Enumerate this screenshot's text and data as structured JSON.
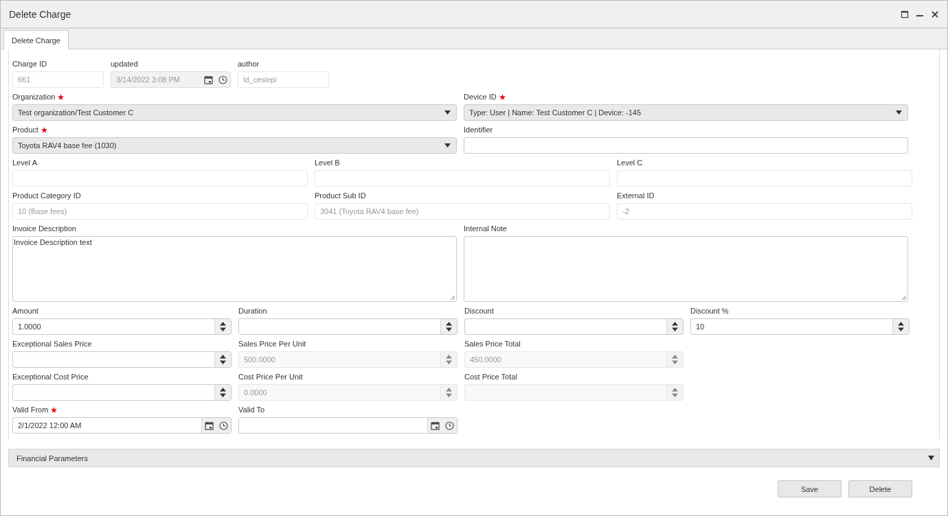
{
  "window": {
    "title": "Delete Charge"
  },
  "tabs": [
    {
      "label": "Delete Charge",
      "selected": true
    }
  ],
  "rows": [
    {
      "kind": "meta",
      "fields": [
        {
          "label": "Charge ID",
          "kind": "text",
          "value": "661",
          "required": false,
          "disabled": true
        },
        {
          "label": "updated",
          "kind": "date",
          "value": "3/14/2022 3:08 PM",
          "required": false,
          "disabled": true
        },
        {
          "label": "author",
          "kind": "text",
          "value": "ld_ceslepi",
          "required": false,
          "disabled": true
        }
      ]
    },
    {
      "kind": "half",
      "fields": [
        {
          "label": "Organization",
          "kind": "select",
          "value": "Test organization/Test Customer C",
          "required": true,
          "disabled": false
        },
        {
          "label": "Device ID",
          "kind": "select",
          "value": "Type: User | Name: Test Customer C | Device: -145",
          "required": true,
          "disabled": false
        }
      ]
    },
    {
      "kind": "half",
      "fields": [
        {
          "label": "Product",
          "kind": "select",
          "value": "Toyota RAV4 base fee (1030)",
          "required": true,
          "disabled": false
        },
        {
          "label": "Identifier",
          "kind": "text",
          "required": false,
          "disabled": false
        }
      ]
    },
    {
      "kind": "third",
      "fields": [
        {
          "label": "Level A",
          "kind": "text",
          "required": false,
          "disabled": true
        },
        {
          "label": "Level B",
          "kind": "text",
          "required": false,
          "disabled": true
        },
        {
          "label": "Level C",
          "kind": "text",
          "required": false,
          "disabled": true
        }
      ]
    },
    {
      "kind": "third",
      "fields": [
        {
          "label": "Product Category ID",
          "kind": "text",
          "value": "10 (Base fees)",
          "required": false,
          "disabled": true
        },
        {
          "label": "Product Sub ID",
          "kind": "text",
          "value": "3041 (Toyota RAV4 base fee)",
          "required": false,
          "disabled": true
        },
        {
          "label": "External ID",
          "kind": "text",
          "value": "-2",
          "required": false,
          "disabled": true
        }
      ]
    },
    {
      "kind": "half",
      "fields": [
        {
          "label": "Invoice Description",
          "kind": "textarea",
          "value": "Invoice Description text",
          "required": false,
          "disabled": false
        },
        {
          "label": "Internal Note",
          "kind": "textarea",
          "required": false,
          "disabled": false
        }
      ]
    },
    {
      "kind": "quarter",
      "fields": [
        {
          "label": "Amount",
          "kind": "number",
          "value": "1.0000",
          "required": false,
          "disabled": false
        },
        {
          "label": "Duration",
          "kind": "number",
          "required": false,
          "disabled": false
        },
        {
          "label": "Discount",
          "kind": "number",
          "required": false,
          "disabled": false
        },
        {
          "label": "Discount %",
          "kind": "number",
          "value": "10",
          "required": false,
          "disabled": false
        }
      ]
    },
    {
      "kind": "quarter",
      "fields": [
        {
          "label": "Exceptional Sales Price",
          "kind": "number",
          "required": false,
          "disabled": false
        },
        {
          "label": "Sales Price Per Unit",
          "kind": "number",
          "value": "500.0000",
          "required": false,
          "disabled": true
        },
        {
          "label": "Sales Price Total",
          "kind": "number",
          "value": "450.0000",
          "required": false,
          "disabled": true
        }
      ]
    },
    {
      "kind": "quarter",
      "fields": [
        {
          "label": "Exceptional Cost Price",
          "kind": "number",
          "required": false,
          "disabled": false
        },
        {
          "label": "Cost Price Per Unit",
          "kind": "number",
          "value": "0.0000",
          "required": false,
          "disabled": true
        },
        {
          "label": "Cost Price Total",
          "kind": "number",
          "required": false,
          "disabled": true
        }
      ]
    },
    {
      "kind": "quarter",
      "fields": [
        {
          "label": "Valid From",
          "kind": "date",
          "value": "2/1/2022 12:00 AM",
          "required": true,
          "disabled": false
        },
        {
          "label": "Valid To",
          "kind": "date",
          "required": false,
          "disabled": false
        }
      ]
    }
  ],
  "sections": [
    {
      "label": "Financial Parameters",
      "expanded": false
    }
  ],
  "buttons": [
    {
      "label": "Save"
    },
    {
      "label": "Delete"
    }
  ]
}
